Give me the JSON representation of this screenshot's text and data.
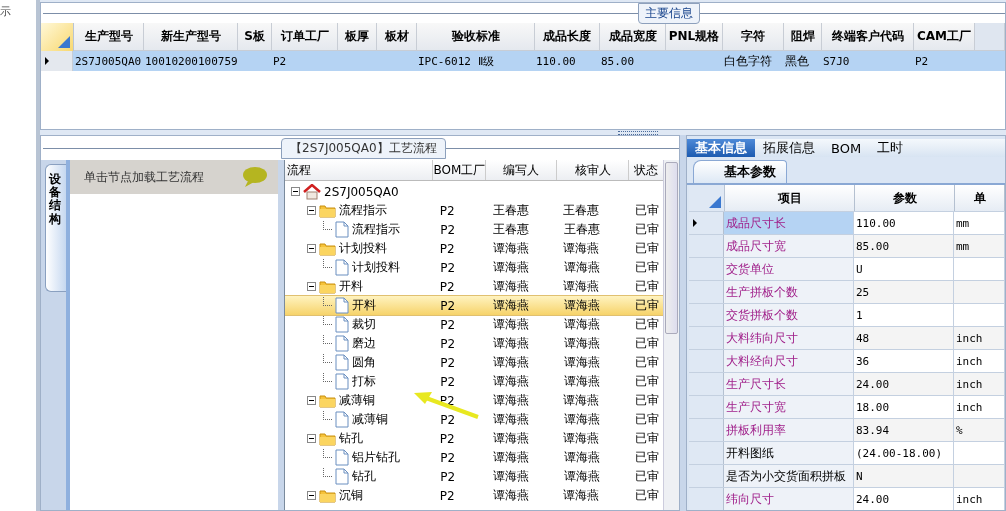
{
  "edge_text": "示",
  "main_info": {
    "title": "主要信息",
    "columns": [
      "生产型号",
      "新生产型号",
      "S板",
      "订单工厂",
      "板厚",
      "板材",
      "验收标准",
      "成品长度",
      "成品宽度",
      "PNL规格",
      "字符",
      "阻焊",
      "终端客户代码",
      "CAM工厂"
    ],
    "rows": [
      {
        "selected": true,
        "cells": [
          "2S7J005QA0",
          "10010200100759",
          "",
          "P2",
          "",
          "",
          "IPC-6012 Ⅱ级",
          "110.00",
          "85.00",
          "",
          "白色字符",
          "黑色",
          "S7J0",
          "P2"
        ]
      }
    ]
  },
  "side_panel": {
    "tab": "设备结构",
    "header": "单击节点加载工艺流程"
  },
  "process": {
    "title": "【2S7J005QA0】工艺流程",
    "columns": [
      "流程",
      "BOM工厂",
      "编写人",
      "核审人",
      "状态"
    ],
    "tree": [
      {
        "label": "2S7J005QA0",
        "kind": "root",
        "selected": false,
        "expanded": true,
        "children": [
          {
            "label": "流程指示",
            "kind": "folder",
            "selected": false,
            "expanded": true,
            "cells": [
              "P2",
              "王春惠",
              "王春惠",
              "已审"
            ],
            "children": [
              {
                "label": "流程指示",
                "kind": "file",
                "selected": false,
                "cells": [
                  "P2",
                  "王春惠",
                  "王春惠",
                  "已审"
                ]
              }
            ]
          },
          {
            "label": "计划投料",
            "kind": "folder",
            "selected": false,
            "expanded": true,
            "cells": [
              "P2",
              "谭海燕",
              "谭海燕",
              "已审"
            ],
            "children": [
              {
                "label": "计划投料",
                "kind": "file",
                "selected": false,
                "cells": [
                  "P2",
                  "谭海燕",
                  "谭海燕",
                  "已审"
                ]
              }
            ]
          },
          {
            "label": "开料",
            "kind": "folder",
            "selected": false,
            "expanded": true,
            "cells": [
              "P2",
              "谭海燕",
              "谭海燕",
              "已审"
            ],
            "children": [
              {
                "label": "开料",
                "kind": "file",
                "selected": true,
                "cells": [
                  "P2",
                  "谭海燕",
                  "谭海燕",
                  "已审"
                ]
              },
              {
                "label": "裁切",
                "kind": "file",
                "selected": false,
                "cells": [
                  "P2",
                  "谭海燕",
                  "谭海燕",
                  "已审"
                ]
              },
              {
                "label": "磨边",
                "kind": "file",
                "selected": false,
                "cells": [
                  "P2",
                  "谭海燕",
                  "谭海燕",
                  "已审"
                ]
              },
              {
                "label": "圆角",
                "kind": "file",
                "selected": false,
                "cells": [
                  "P2",
                  "谭海燕",
                  "谭海燕",
                  "已审"
                ]
              },
              {
                "label": "打标",
                "kind": "file",
                "selected": false,
                "cells": [
                  "P2",
                  "谭海燕",
                  "谭海燕",
                  "已审"
                ]
              }
            ]
          },
          {
            "label": "减薄铜",
            "kind": "folder",
            "selected": false,
            "expanded": true,
            "cells": [
              "P2",
              "谭海燕",
              "谭海燕",
              "已审"
            ],
            "children": [
              {
                "label": "减薄铜",
                "kind": "file",
                "selected": false,
                "cells": [
                  "P2",
                  "谭海燕",
                  "谭海燕",
                  "已审"
                ]
              }
            ]
          },
          {
            "label": "钻孔",
            "kind": "folder",
            "selected": false,
            "expanded": true,
            "cells": [
              "P2",
              "谭海燕",
              "谭海燕",
              "已审"
            ],
            "children": [
              {
                "label": "铝片钻孔",
                "kind": "file",
                "selected": false,
                "cells": [
                  "P2",
                  "谭海燕",
                  "谭海燕",
                  "已审"
                ]
              },
              {
                "label": "钻孔",
                "kind": "file",
                "selected": false,
                "cells": [
                  "P2",
                  "谭海燕",
                  "谭海燕",
                  "已审"
                ]
              }
            ]
          },
          {
            "label": "沉铜",
            "kind": "folder",
            "selected": false,
            "expanded": true,
            "cells": [
              "P2",
              "谭海燕",
              "谭海燕",
              "已审"
            ]
          }
        ]
      }
    ]
  },
  "detail": {
    "tabs": [
      {
        "label": "基本信息",
        "selected": true
      },
      {
        "label": "拓展信息",
        "selected": false
      },
      {
        "label": "BOM",
        "selected": false
      },
      {
        "label": "工时",
        "selected": false
      }
    ],
    "subtab": "基本参数",
    "columns": [
      "项目",
      "参数",
      "单"
    ],
    "rows": [
      {
        "item": "成品尺寸长",
        "value": "110.00",
        "unit": "mm",
        "highlighted": true,
        "selected": true
      },
      {
        "item": "成品尺寸宽",
        "value": "85.00",
        "unit": "mm",
        "highlighted": true,
        "selected": false
      },
      {
        "item": "交货单位",
        "value": "U",
        "unit": "",
        "highlighted": true,
        "selected": false
      },
      {
        "item": "生产拼板个数",
        "value": "25",
        "unit": "",
        "highlighted": true,
        "selected": false
      },
      {
        "item": "交货拼板个数",
        "value": "1",
        "unit": "",
        "highlighted": true,
        "selected": false
      },
      {
        "item": "大料纬向尺寸",
        "value": "48",
        "unit": "inch",
        "highlighted": true,
        "selected": false
      },
      {
        "item": "大料经向尺寸",
        "value": "36",
        "unit": "inch",
        "highlighted": true,
        "selected": false
      },
      {
        "item": "生产尺寸长",
        "value": "24.00",
        "unit": "inch",
        "highlighted": true,
        "selected": false
      },
      {
        "item": "生产尺寸宽",
        "value": "18.00",
        "unit": "inch",
        "highlighted": true,
        "selected": false
      },
      {
        "item": "拼板利用率",
        "value": "83.94",
        "unit": "%",
        "highlighted": true,
        "selected": false
      },
      {
        "item": "开料图纸",
        "value": "(24.00-18.00)",
        "unit": "",
        "highlighted": false,
        "selected": false
      },
      {
        "item": "是否为小交货面积拼板",
        "value": "N",
        "unit": "",
        "highlighted": false,
        "selected": false
      },
      {
        "item": "纬向尺寸",
        "value": "24.00",
        "unit": "inch",
        "highlighted": true,
        "selected": false
      }
    ]
  }
}
